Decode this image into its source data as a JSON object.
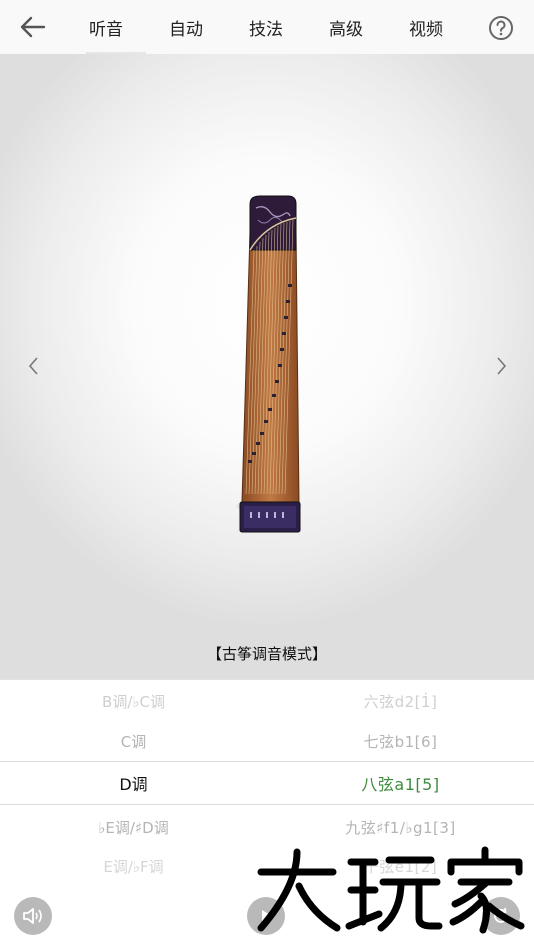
{
  "header": {
    "back_icon": "arrow-left-icon",
    "tabs": [
      {
        "label": "听音",
        "active": true
      },
      {
        "label": "自动"
      },
      {
        "label": "技法"
      },
      {
        "label": "高级"
      },
      {
        "label": "视频"
      }
    ],
    "help_icon": "question-circle-icon"
  },
  "stage": {
    "instrument": "guzheng",
    "prev_icon": "chevron-left-icon",
    "next_icon": "chevron-right-icon",
    "mode_label": "【古筝调音模式】"
  },
  "picker": {
    "rows": [
      {
        "key": "B调/♭C调",
        "string": "六弦d2[1̇]"
      },
      {
        "key": "C调",
        "string": "七弦b1[6]"
      },
      {
        "key": "D调",
        "string": "八弦a1[5]",
        "selected": true
      },
      {
        "key": "♭E调/♯D调",
        "string": "九弦♯f1/♭g1[3]"
      },
      {
        "key": "E调/♭F调",
        "string": "十弦e1[2]"
      }
    ],
    "selected_color": "#3d8b3d"
  },
  "footer": {
    "sound_icon": "speaker-icon",
    "play_icon": "play-icon",
    "reset_icon": "refresh-icon",
    "watermark": "大玩家"
  }
}
